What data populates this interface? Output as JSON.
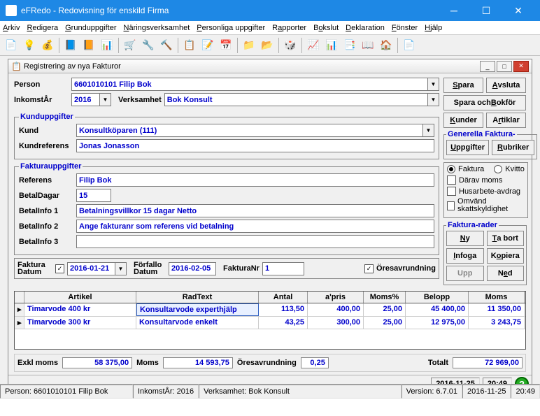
{
  "window": {
    "title": "eFRedo - Redovisning för enskild Firma"
  },
  "menu": [
    "Arkiv",
    "Redigera",
    "Grunduppgifter",
    "Näringsverksamhet",
    "Personliga uppgifter",
    "Rapporter",
    "Bokslut",
    "Deklaration",
    "Fönster",
    "Hjälp"
  ],
  "subwindow": {
    "title": "Registrering av nya Fakturor"
  },
  "form": {
    "person_lbl": "Person",
    "person_val": "6601010101     Filip Bok",
    "year_lbl": "InkomstÅr",
    "year_val": "2016",
    "verk_lbl": "Verksamhet",
    "verk_val": "Bok Konsult"
  },
  "buttons": {
    "spara": "Spara",
    "avsluta": "Avsluta",
    "sparabok": "Spara och Bokför",
    "kunder": "Kunder",
    "artiklar": "Artiklar",
    "uppgifter": "Uppgifter",
    "rubriker": "Rubriker",
    "ny": "Ny",
    "tabort": "Ta bort",
    "infoga": "Infoga",
    "kopiera": "Kopiera",
    "upp": "Upp",
    "ned": "Ned"
  },
  "kund": {
    "legend": "Kunduppgifter",
    "kund_lbl": "Kund",
    "kund_val": "Konsultköparen (111)",
    "ref_lbl": "Kundreferens",
    "ref_val": "Jonas Jonasson"
  },
  "gen": {
    "legend": "Generella Faktura-"
  },
  "fakt": {
    "legend": "Fakturauppgifter",
    "referens_lbl": "Referens",
    "referens_val": "Filip Bok",
    "betaldagar_lbl": "BetalDagar",
    "betaldagar_val": "15",
    "info1_lbl": "BetalInfo 1",
    "info1_val": "Betalningsvillkor 15 dagar Netto",
    "info2_lbl": "BetalInfo 2",
    "info2_val": "Ange fakturanr som referens vid betalning",
    "info3_lbl": "BetalInfo 3",
    "info3_val": ""
  },
  "opts": {
    "faktura": "Faktura",
    "kvitto": "Kvitto",
    "darav": "Därav moms",
    "husarbete": "Husarbete-avdrag",
    "omvand": "Omvänd skattskyldighet"
  },
  "rader_legend": "Faktura-rader",
  "dates": {
    "fdatum_lbl": "Faktura Datum",
    "fdatum_val": "2016-01-21",
    "forfallo_lbl": "Förfallo Datum",
    "forfallo_val": "2016-02-05",
    "nr_lbl": "FakturaNr",
    "nr_val": "1",
    "ores": "Öresavrundning"
  },
  "grid": {
    "headers": [
      "Artikel",
      "RadText",
      "Antal",
      "a'pris",
      "Moms%",
      "Belopp",
      "Moms"
    ],
    "rows": [
      {
        "art": "Timarvode 400 kr",
        "rad": "Konsultarvode experthjälp",
        "ant": "113,50",
        "pris": "400,00",
        "momsP": "25,00",
        "bel": "45 400,00",
        "moms": "11 350,00",
        "sel": true
      },
      {
        "art": "Timarvode 300 kr",
        "rad": "Konsultarvode enkelt",
        "ant": "43,25",
        "pris": "300,00",
        "momsP": "25,00",
        "bel": "12 975,00",
        "moms": "3 243,75"
      }
    ]
  },
  "totals": {
    "exkl_lbl": "Exkl moms",
    "exkl": "58 375,00",
    "moms_lbl": "Moms",
    "moms": "14 593,75",
    "ores_lbl": "Öresavrundning",
    "ores": "0,25",
    "totalt_lbl": "Totalt",
    "totalt": "72 969,00"
  },
  "substatus": {
    "date": "2016-11-25",
    "time": "20:49"
  },
  "status": {
    "person": "Person: 6601010101 Filip Bok",
    "year": "InkomstÅr: 2016",
    "verk": "Verksamhet: Bok Konsult",
    "ver": "Version: 6.7.01",
    "date": "2016-11-25",
    "time": "20:49"
  }
}
